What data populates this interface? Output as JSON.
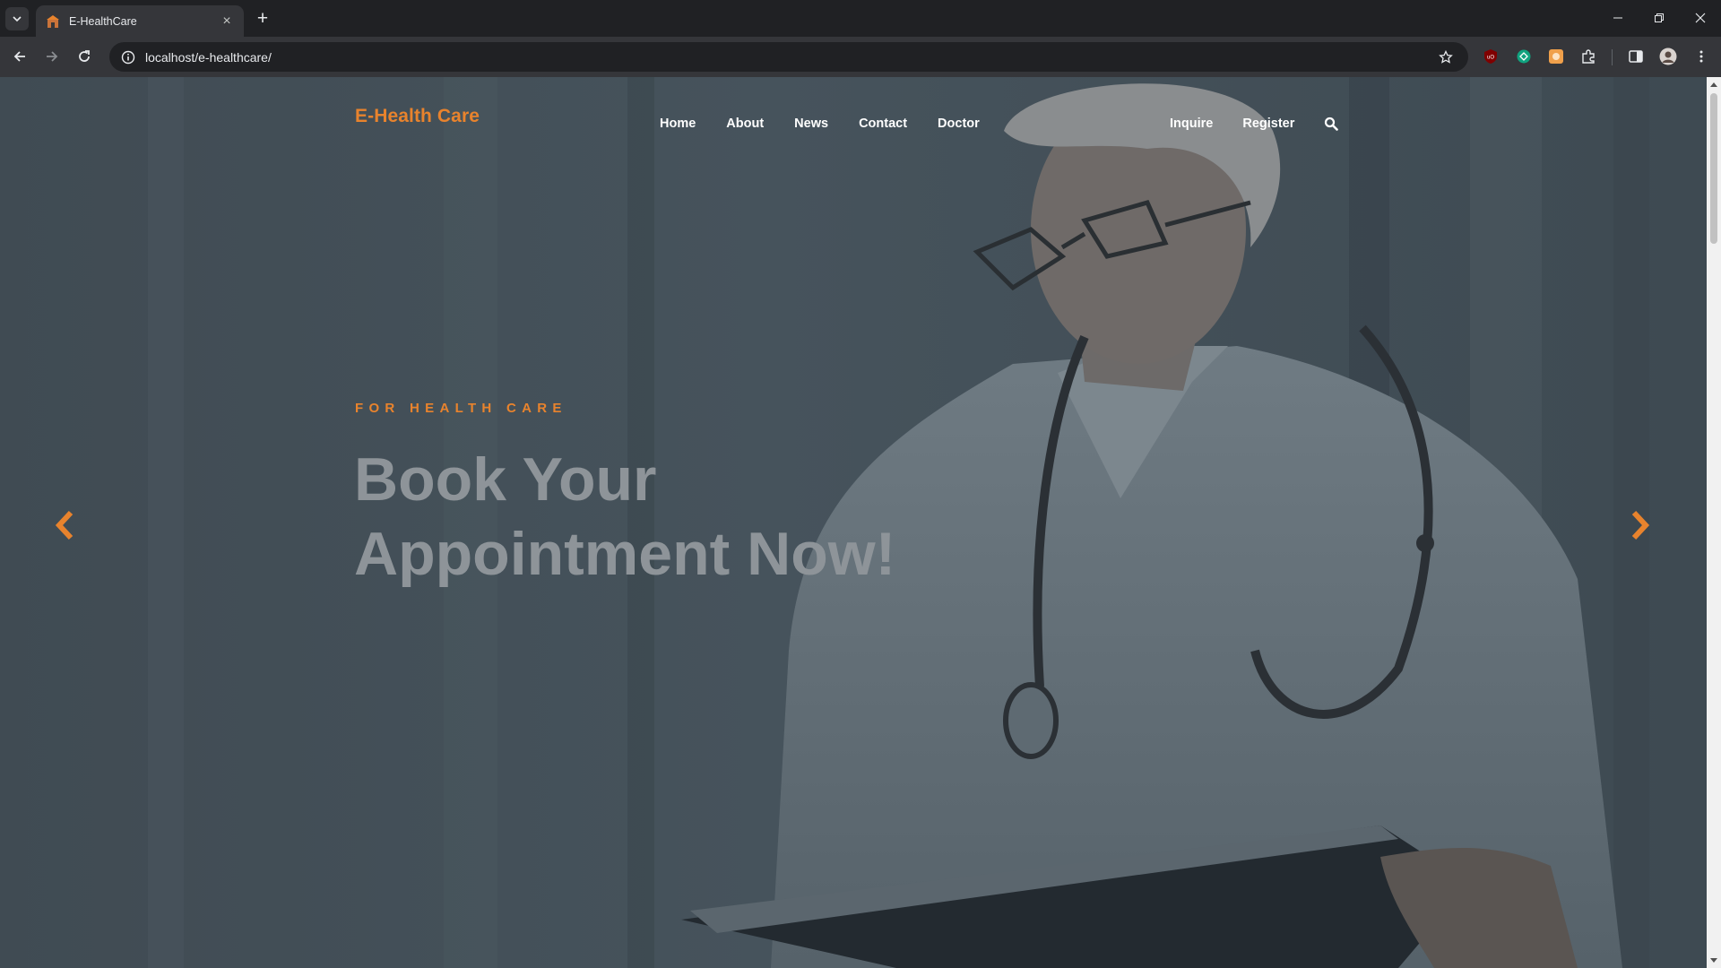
{
  "browser": {
    "tab_title": "E-HealthCare",
    "url": "localhost/e-healthcare/"
  },
  "site": {
    "brand": "E-Health Care",
    "nav": [
      "Home",
      "About",
      "News",
      "Contact",
      "Doctor"
    ],
    "nav_right": [
      "Inquire",
      "Register"
    ]
  },
  "hero": {
    "kicker": "FOR HEALTH CARE",
    "headline_line1": "Book Your",
    "headline_line2": "Appointment Now!"
  },
  "colors": {
    "brand": "#e8832d",
    "hero_overlay": "#3f4c56",
    "headline": "#8e9499"
  }
}
